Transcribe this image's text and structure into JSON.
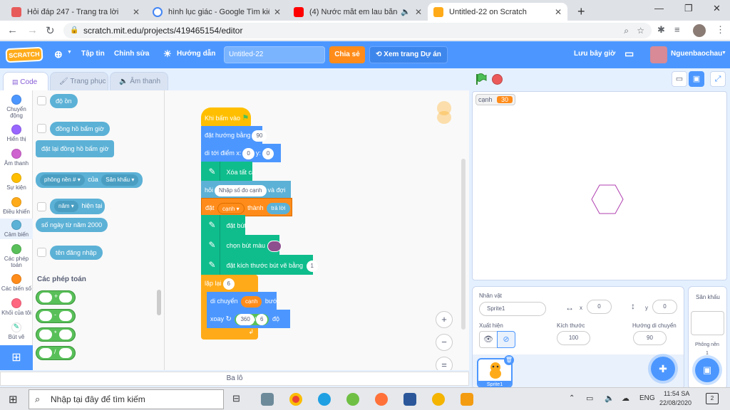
{
  "browser": {
    "tabs": [
      {
        "label": "Hỏi đáp 247 - Trang tra lời",
        "color": "#e75b5b"
      },
      {
        "label": "hình lục giác - Google Tìm kiếm",
        "color": "#4285f4"
      },
      {
        "label": "(4) Nước mắt em lau bằng tì",
        "color": "#ff0000"
      },
      {
        "label": "Untitled-22 on Scratch",
        "color": "#ffab19"
      }
    ],
    "new_tab": "+",
    "url": "scratch.mit.edu/projects/419465154/editor"
  },
  "menu": {
    "logo": "SCRATCH",
    "file": "Tập tin",
    "edit": "Chỉnh sửa",
    "tutorials": "Hướng dẫn",
    "title": "Untitled-22",
    "share": "Chia sẻ",
    "see_project": "Xem trang Dự án",
    "save_now": "Lưu bây giờ",
    "username": "Nguenbaochau"
  },
  "editor_tabs": {
    "code": "Code",
    "costumes": "Trang phục",
    "sounds": "Âm thanh"
  },
  "categories": [
    {
      "label": "Chuyển động",
      "color": "#4c97ff"
    },
    {
      "label": "Hiển thị",
      "color": "#9966ff"
    },
    {
      "label": "Âm thanh",
      "color": "#cf63cf"
    },
    {
      "label": "Sự kiện",
      "color": "#ffbf00"
    },
    {
      "label": "Điều khiển",
      "color": "#ffab19"
    },
    {
      "label": "Cảm biến",
      "color": "#5cb1d6"
    },
    {
      "label": "Các phép toán",
      "color": "#59c059"
    },
    {
      "label": "Các biến số",
      "color": "#ff8c1a"
    },
    {
      "label": "Khối của tôi",
      "color": "#ff6680"
    },
    {
      "label": "Bút vẽ",
      "color": "#0fbd8c"
    }
  ],
  "palette": {
    "loudness": "độ ồn",
    "timer": "đồng hồ bấm giờ",
    "reset_timer": "đặt lại đồng hồ bấm giờ",
    "backdrop_of": "phông nền #",
    "of": "của",
    "stage": "Sân khấu",
    "year": "năm",
    "current": "hiện tại",
    "days_since": "số ngày từ năm 2000",
    "username": "tên đăng nhập",
    "operators_heading": "Các phép toán",
    "ops": [
      "+",
      "-",
      "*",
      "/"
    ]
  },
  "script": {
    "when_flag": "Khi bấm vào",
    "point_dir": "đặt hướng bằng",
    "point_val": "90",
    "goto": "di tới điểm x:",
    "goto_x": "0",
    "goto_y_label": "y:",
    "goto_y": "0",
    "clear": "Xóa tất cả",
    "ask": "hỏi",
    "ask_text": "Nhập số đo cạnh",
    "and_wait": "và đợi",
    "set": "đặt",
    "set_var": "cạnh",
    "set_to": "thành",
    "answer": "trả lời",
    "pen_down": "đặt bút",
    "set_pen_color": "chọn bút màu",
    "pen_size": "đặt kích thước bút vẽ bằng",
    "pen_size_val": "1",
    "repeat": "lặp lại",
    "repeat_val": "6",
    "move": "di chuyển",
    "move_var": "cạnh",
    "steps": "bước",
    "turn": "xoay",
    "turn_a": "360",
    "turn_div": "/",
    "turn_b": "6",
    "degrees": "độ",
    "zoom_in": "+",
    "zoom_out": "−",
    "zoom_reset": "="
  },
  "stage": {
    "var_name": "cạnh",
    "var_value": "30"
  },
  "sprite_info": {
    "sprite_label": "Nhân vật",
    "sprite_name": "Sprite1",
    "x_label": "x",
    "x": "0",
    "y_label": "y",
    "y": "0",
    "show_label": "Xuất hiện",
    "size_label": "Kích thước",
    "size": "100",
    "direction_label": "Hướng di chuyển",
    "direction": "90",
    "thumb_name": "Sprite1"
  },
  "stage_pane": {
    "label": "Sân khấu",
    "backdrops_label": "Phông nền",
    "backdrops_count": "1"
  },
  "backpack": "Ba lô",
  "taskbar": {
    "search": "Nhập tại đây để tìm kiếm",
    "lang": "ENG",
    "time": "11:54 SA",
    "date": "22/08/2020",
    "notif": "2"
  }
}
